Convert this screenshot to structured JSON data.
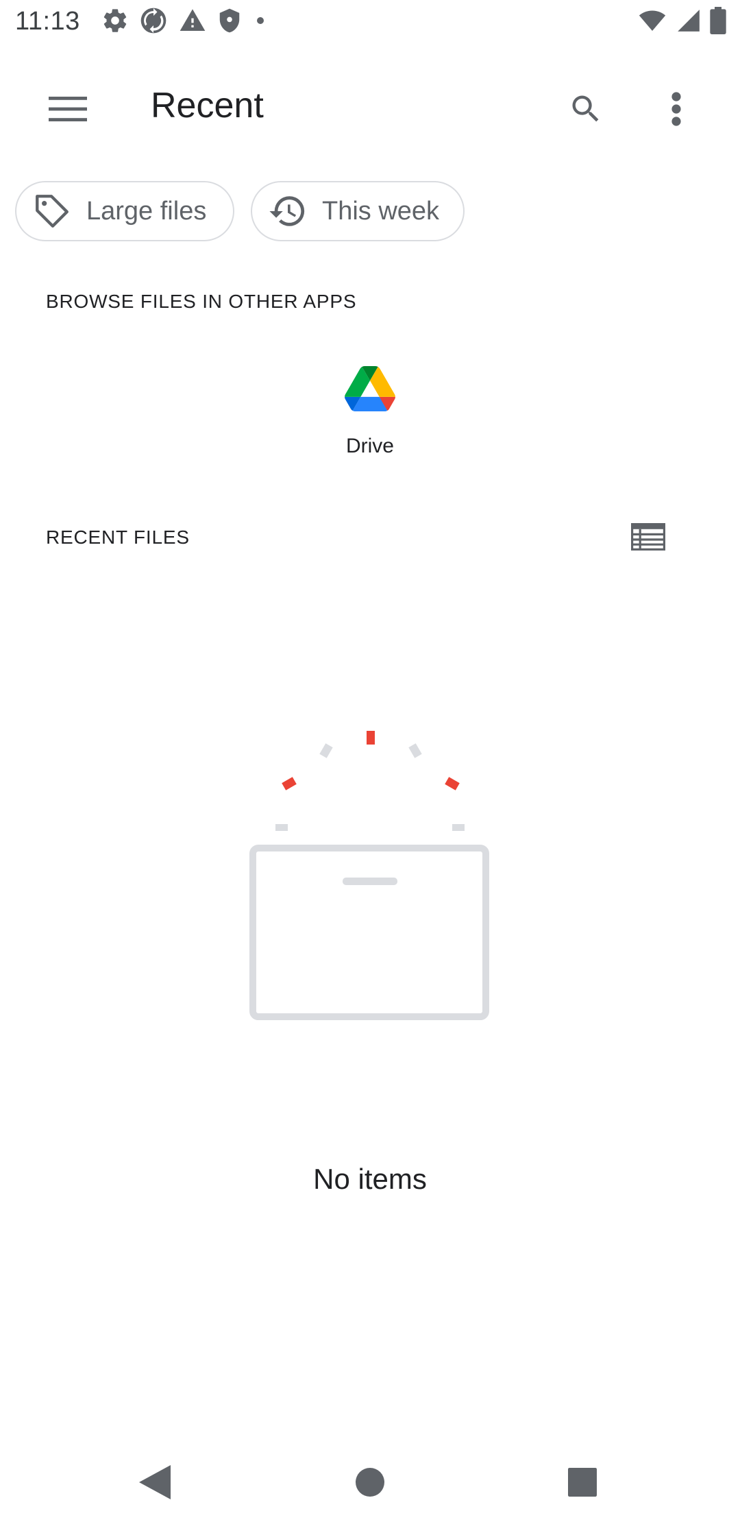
{
  "status_bar": {
    "time": "11:13",
    "left_icons": [
      "settings-icon",
      "sync-icon",
      "warning-icon",
      "shield-icon",
      "dot-icon"
    ],
    "right_icons": [
      "wifi-icon",
      "cell-signal-icon",
      "battery-icon"
    ]
  },
  "app_bar": {
    "title": "Recent",
    "menu_icon": "hamburger-menu-icon",
    "search_icon": "search-icon",
    "more_icon": "more-vert-icon"
  },
  "chips": [
    {
      "label": "Large files",
      "icon": "tag-icon"
    },
    {
      "label": "This week",
      "icon": "history-icon"
    }
  ],
  "browse_section": {
    "header": "BROWSE FILES IN OTHER APPS",
    "apps": [
      {
        "label": "Drive",
        "icon": "google-drive-icon"
      }
    ]
  },
  "recent_section": {
    "header": "RECENT FILES",
    "view_toggle_icon": "list-view-icon"
  },
  "empty_state": {
    "text": "No items",
    "accent_color": "#ea4335",
    "muted_color": "#dadce0"
  },
  "nav_bar": {
    "back_icon": "back-triangle-icon",
    "home_icon": "home-circle-icon",
    "recents_icon": "recents-square-icon"
  }
}
